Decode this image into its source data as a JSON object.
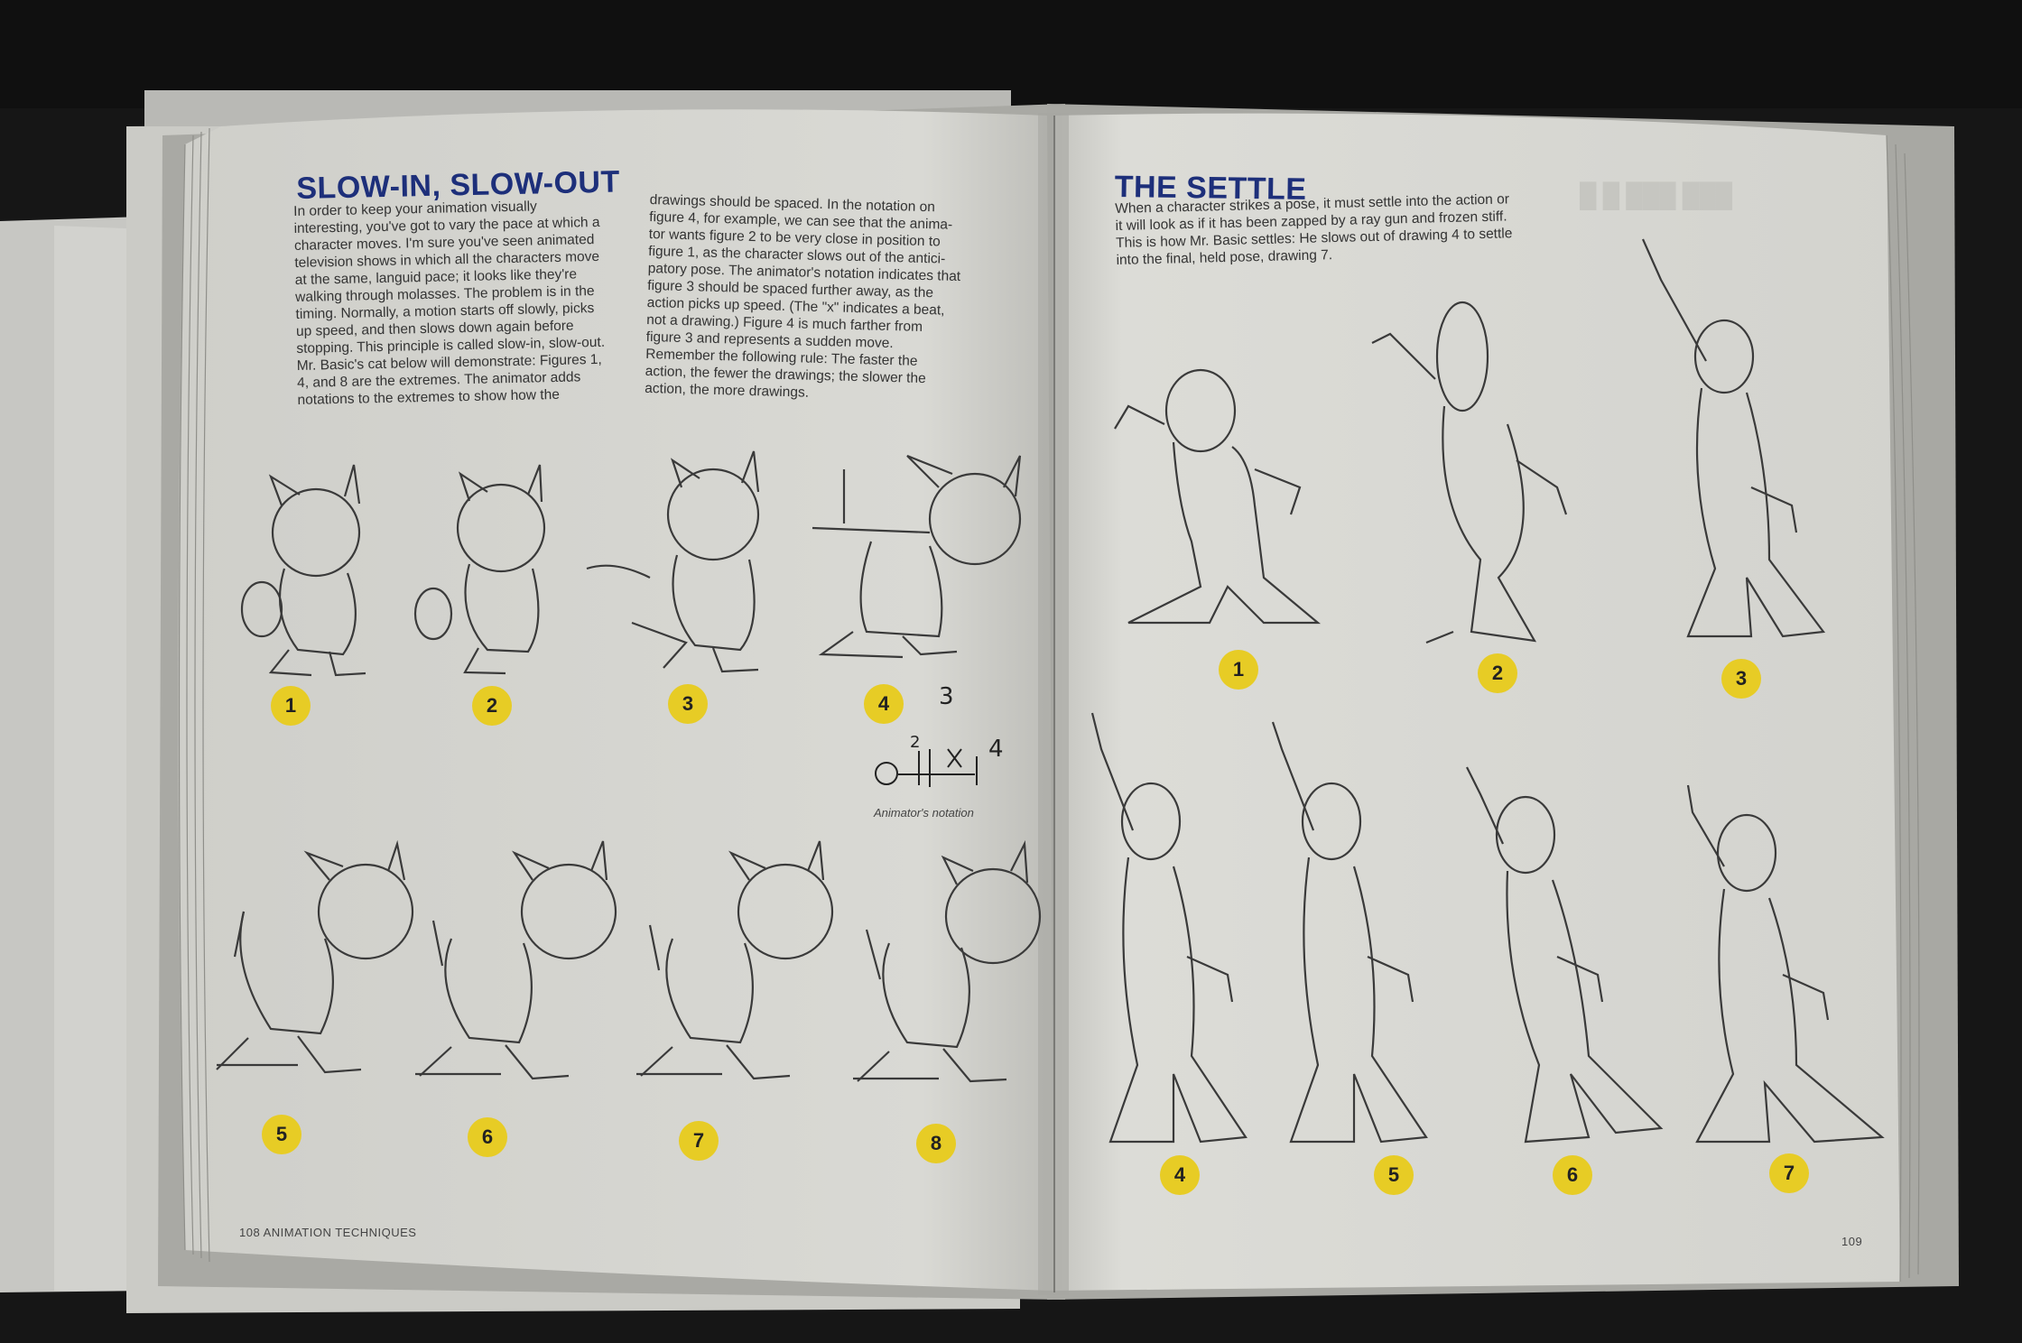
{
  "left_page": {
    "heading": "SLOW-IN, SLOW-OUT",
    "column1": "In order to keep your animation visually\ninteresting, you've got to vary the pace at which a\ncharacter moves. I'm sure you've seen animated\ntelevision shows in which all the characters move\nat the same, languid pace; it looks like they're\nwalking through molasses. The problem is in the\ntiming. Normally, a motion starts off slowly, picks\nup speed, and then slows down again before\nstopping. This principle is called slow-in, slow-out.\nMr. Basic's cat below will demonstrate: Figures 1,\n4, and 8 are the extremes. The animator adds\nnotations to the extremes to show how the",
    "column2": "drawings should be spaced. In the notation on\nfigure 4, for example, we can see that the anima-\ntor wants figure 2 to be very close in position to\nfigure 1, as the character slows out of the antici-\npatory pose. The animator's notation indicates that\nfigure 3 should be spaced further away, as the\naction picks up speed. (The \"x\" indicates a beat,\nnot a drawing.) Figure 4 is much farther from\nfigure 3 and represents a sudden move.\n   Remember the following rule: The faster the\naction, the fewer the drawings; the slower the\naction, the more drawings.",
    "figure_numbers": [
      "1",
      "2",
      "3",
      "4",
      "5",
      "6",
      "7",
      "8"
    ],
    "notation_caption": "Animator's notation",
    "footer": "108  ANIMATION TECHNIQUES"
  },
  "right_page": {
    "heading": "THE SETTLE",
    "body": "When a character strikes a pose, it must settle into the action or\nit will look as if it has been zapped by a ray gun and frozen stiff.\nThis is how Mr. Basic settles: He slows out of drawing 4 to settle\ninto the final, held pose, drawing 7.",
    "figure_numbers": [
      "1",
      "2",
      "3",
      "4",
      "5",
      "6",
      "7"
    ],
    "footer": "109"
  },
  "colors": {
    "heading": "#1d2f7a",
    "badge": "#e7cc25",
    "paper": "#dcdcd6",
    "background": "#171717"
  }
}
